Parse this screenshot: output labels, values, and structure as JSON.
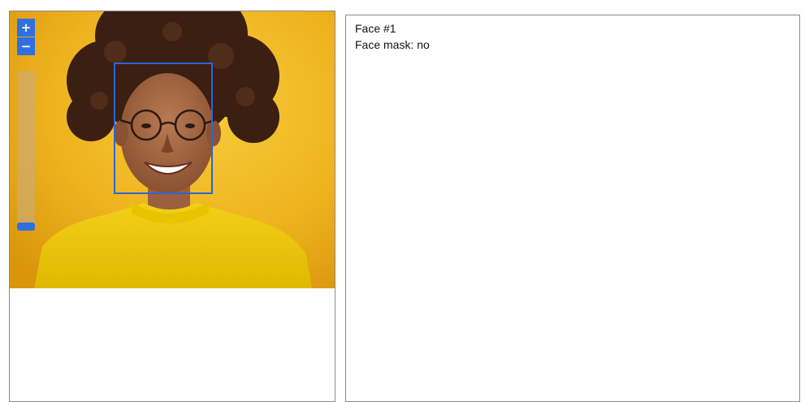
{
  "viewer": {
    "zoom_in_label": "+",
    "zoom_out_label": "−",
    "zoom_level": 1.0,
    "image_alt": "woman with glasses on yellow background"
  },
  "detections": [
    {
      "title": "Face #1",
      "mask_label": "Face mask",
      "mask_value": "no",
      "mask_line": "Face mask: no"
    }
  ],
  "colors": {
    "accent": "#2f6fe0",
    "box": "#2e64d6",
    "background": "#f0b826"
  }
}
